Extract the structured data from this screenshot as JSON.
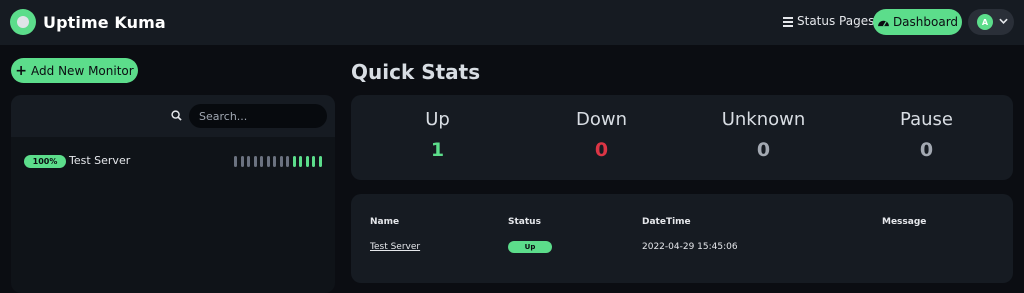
{
  "header": {
    "brand": "Uptime Kuma",
    "status_pages_label": "Status Pages",
    "dashboard_label": "Dashboard",
    "avatar_initial": "A"
  },
  "sidebar": {
    "add_monitor_label": "Add New Monitor",
    "search_placeholder": "Search...",
    "monitors": [
      {
        "name": "Test Server",
        "uptime": "100%",
        "heartbeats": [
          "empty",
          "empty",
          "empty",
          "empty",
          "empty",
          "empty",
          "empty",
          "empty",
          "empty",
          "up",
          "up",
          "up",
          "up",
          "up"
        ]
      }
    ]
  },
  "quick_stats": {
    "title": "Quick Stats",
    "items": [
      {
        "label": "Up",
        "value": "1",
        "color": "#5cdd8b"
      },
      {
        "label": "Down",
        "value": "0",
        "color": "#dc3545"
      },
      {
        "label": "Unknown",
        "value": "0",
        "color": "#a3a9b2"
      },
      {
        "label": "Pause",
        "value": "0",
        "color": "#a3a9b2"
      }
    ]
  },
  "events": {
    "headers": {
      "name": "Name",
      "status": "Status",
      "datetime": "DateTime",
      "message": "Message"
    },
    "rows": [
      {
        "name": "Test Server",
        "status": "Up",
        "datetime": "2022-04-29 15:45:06",
        "message": ""
      }
    ]
  },
  "colors": {
    "accent": "#5cdd8b",
    "danger": "#dc3545",
    "muted": "#a3a9b2",
    "heartbeat_empty": "#6b7280"
  },
  "icons": {
    "logo": "uptime-kuma-logo",
    "status_pages": "list-icon",
    "dashboard": "tachometer-icon",
    "profile_menu": "chevron-down-icon",
    "add": "plus-icon",
    "search": "search-icon"
  }
}
